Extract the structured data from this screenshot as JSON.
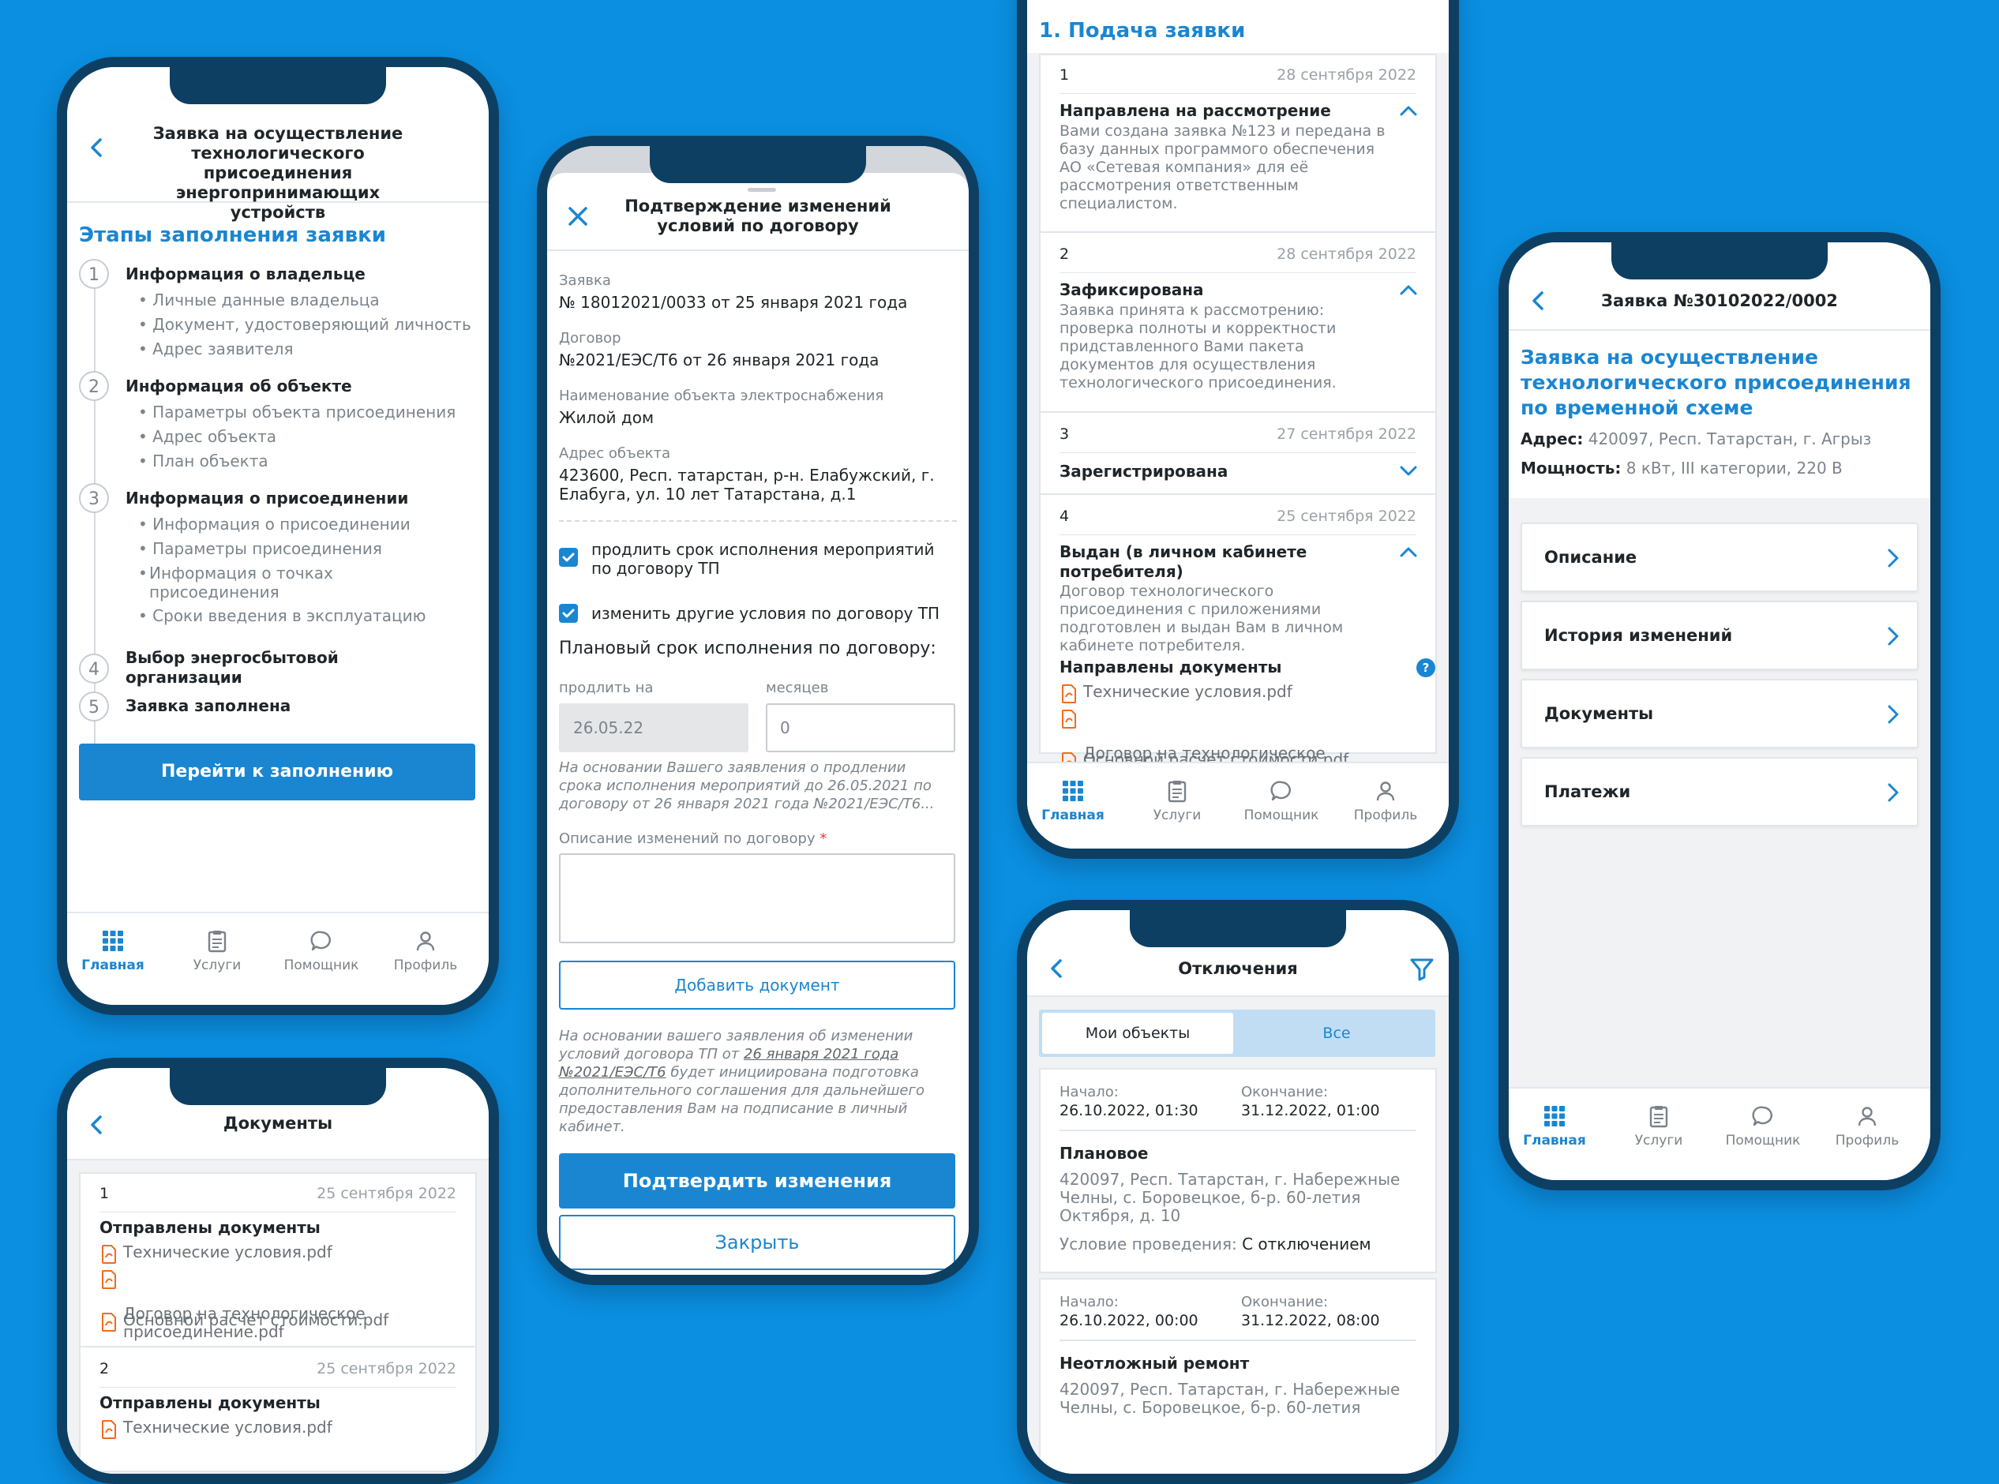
{
  "tabs": {
    "home": "Главная",
    "services": "Услуги",
    "assistant": "Помощник",
    "profile": "Профиль"
  },
  "phone1": {
    "title": "Заявка на осуществление\nтехнологического присоединения\nэнергопринимающих устройств",
    "section": "Этапы заполнения заявки",
    "steps": [
      {
        "num": "1",
        "title": "Информация о владельце",
        "subs": [
          "Личные данные владельца",
          "Документ, удостоверяющий личность",
          "Адрес заявителя"
        ]
      },
      {
        "num": "2",
        "title": "Информация об объекте",
        "subs": [
          "Параметры объекта присоединения",
          "Адрес объекта",
          "План объекта"
        ]
      },
      {
        "num": "3",
        "title": "Информация о присоединении",
        "subs": [
          "Информация о присоединении",
          "Параметры присоединения",
          "Информация о точках\nприсоединения",
          "Сроки введения в эксплуатацию"
        ]
      },
      {
        "num": "4",
        "title": "Выбор энергосбытовой\nорганизации",
        "subs": []
      },
      {
        "num": "5",
        "title": "Заявка заполнена",
        "subs": []
      }
    ],
    "button": "Перейти к заполнению"
  },
  "phone2": {
    "title": "Документы",
    "items": [
      {
        "num": "1",
        "date": "25 сентября 2022",
        "heading": "Отправлены документы",
        "files": [
          "Технические условия.pdf",
          "Договор на технологическое\nприсоединение.pdf",
          "Основной расчет стоимости.pdf"
        ]
      },
      {
        "num": "2",
        "date": "25 сентября 2022",
        "heading": "Отправлены документы",
        "files": [
          "Технические условия.pdf"
        ]
      }
    ]
  },
  "phone3": {
    "title": "Подтверждение изменений\nусловий по договору",
    "f1_label": "Заявка",
    "f1_value": "№ 18012021/0033 от  25 января 2021 года",
    "f2_label": "Договор",
    "f2_value": "№2021/ЕЭС/Т6 от 26 января 2021 года",
    "f3_label": "Наименование объекта электроснабжения",
    "f3_value": "Жилой дом",
    "f4_label": "Адрес объекта",
    "f4_value": "423600, Респ. татарстан, р-н. Елабужский, г.\nЕлабуга, ул. 10 лет Татарстана, д.1",
    "check1": "продлить срок исполнения мероприятий\nпо договору ТП",
    "check2": "изменить другие условия по договору ТП",
    "plan_label": "Плановый срок исполнения по договору:",
    "extend_label": "продлить на",
    "months_label": "месяцев",
    "extend_value": "26.05.22",
    "months_value": "0",
    "note1": "На основании Вашего заявления о продлении\nсрока исполнения мероприятий до 26.05.2021 по\nдоговору от 26 января 2021 года №2021/ЕЭС/Т6...",
    "desc_label": "Описание изменений по договору",
    "required": "*",
    "add_doc": "Добавить документ",
    "note2_a": "На основании вашего заявления об изменении\nусловий договора ТП от ",
    "note2_link1": "26 января 2021 года",
    "note2_link2": "№2021/ЕЭС/Т6",
    "note2_b": " будет инициирована подготовка\nдополнительного соглашения для дальнейшего\nпредоставления Вам на подписание в личный\nкабинет.",
    "confirm": "Подтвердить изменения",
    "close": "Закрыть"
  },
  "phone4": {
    "section": "1. Подача заявки",
    "items": [
      {
        "num": "1",
        "date": "28 сентября 2022",
        "title": "Направлена на рассмотрение",
        "text": "Вами создана заявка №123 и передана в\nбазу данных программого обеспечения\nАО «Сетевая компания» для её\nрассмотрения ответственным\nспециалистом."
      },
      {
        "num": "2",
        "date": "28 сентября 2022",
        "title": "Зафиксирована",
        "text": "Заявка принята к рассмотрению:\nпроверка полноты и корректности\nпридставленного Вами пакета\nдокументов для осуществления\nтехнологического присоединения."
      },
      {
        "num": "3",
        "date": "27 сентября 2022",
        "title": "Зарегистрирована",
        "text": ""
      },
      {
        "num": "4",
        "date": "25 сентября 2022",
        "title": "Выдан (в личном кабинете\nпотребителя)",
        "text": "Договор технологического\nприсоединения с приложениями\nподготовлен и выдан Вам в личном\nкабинете потребителя.",
        "docs_heading": "Направлены документы",
        "files": [
          "Технические условия.pdf",
          "Договор на технологическое\nприсоединение.pdf",
          "Основной расчет стоимости.pdf"
        ]
      }
    ]
  },
  "phone5": {
    "title": "Отключения",
    "seg_mine": "Мои объекты",
    "seg_all": "Все",
    "cards": [
      {
        "start_label": "Начало:",
        "start": "26.10.2022, 01:30",
        "end_label": "Окончание:",
        "end": "31.12.2022, 01:00",
        "type": "Плановое",
        "address": "420097, Респ. Татарстан, г. Набережные\nЧелны, с. Боровецкое, б-р. 60-летия\nОктября, д. 10",
        "cond_label": "Условие проведения:",
        "cond": "С отключением"
      },
      {
        "start_label": "Начало:",
        "start": "26.10.2022, 00:00",
        "end_label": "Окончание:",
        "end": "31.12.2022, 08:00",
        "type": "Неотложный ремонт",
        "address": "420097, Респ. Татарстан, г. Набережные\nЧелны, с. Боровецкое, б-р. 60-летия",
        "cond_label": "",
        "cond": ""
      }
    ]
  },
  "phone6": {
    "title": "Заявка №30102022/0002",
    "heading": "Заявка на осуществление\nтехнологического присоединения\nпо временной схеме",
    "addr_label": "Адрес:",
    "addr": "420097, Респ. Татарстан, г. Агрыз",
    "power_label": "Мощность:",
    "power": "8 кВт, III категории, 220 В",
    "menu": [
      "Описание",
      "История изменений",
      "Документы",
      "Платежи"
    ]
  },
  "colors": {
    "accent": "#1a86d1",
    "background": "#0b8fe0",
    "frame": "#0d3f63",
    "pdf": "#f26b1d"
  }
}
